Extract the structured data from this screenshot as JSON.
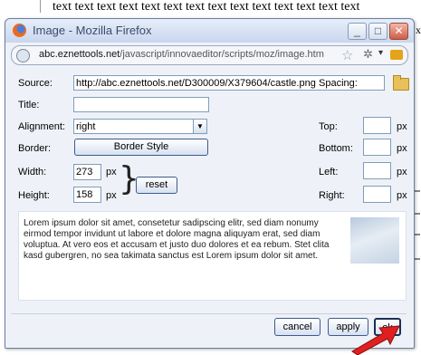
{
  "background": {
    "text": "text text text text text text text text text text text text text text",
    "edge_text": "x"
  },
  "window": {
    "title": "Image - Mozilla Firefox",
    "controls": {
      "minimize": "_",
      "maximize": "□",
      "close": "✕"
    },
    "url": {
      "domain": "abc.eznettools.net",
      "path": "/javascript/innovaeditor/scripts/moz/image.htm"
    }
  },
  "form": {
    "source_label": "Source:",
    "source_value": "http://abc.eznettools.net/D300009/X379604/castle.png",
    "title_label": "Title:",
    "title_value": "",
    "alignment_label": "Alignment:",
    "alignment_value": "right",
    "border_label": "Border:",
    "border_style_button": "Border Style",
    "width_label": "Width:",
    "width_value": "273",
    "width_unit": "px",
    "height_label": "Height:",
    "height_value": "158",
    "height_unit": "px",
    "reset_button": "reset",
    "spacing_label": "Spacing:",
    "top_label": "Top:",
    "bottom_label": "Bottom:",
    "left_label": "Left:",
    "right_label": "Right:",
    "spacing_unit": "px"
  },
  "preview": {
    "text": "Lorem ipsum dolor sit amet, consetetur sadipscing elitr, sed diam nonumy eirmod tempor invidunt ut labore et dolore magna aliquyam erat, sed diam voluptua. At vero eos et accusam et justo duo dolores et ea rebum. Stet clita kasd gubergren, no sea takimata sanctus est Lorem ipsum dolor sit amet."
  },
  "actions": {
    "cancel": "cancel",
    "apply": "apply",
    "ok": "ok"
  },
  "colors": {
    "accent": "#3d5a8a",
    "arrow": "#e02020"
  },
  "icons": [
    "firefox-icon",
    "globe-icon",
    "star-icon",
    "tools-icon",
    "rss-icon",
    "folder-icon",
    "cursor-arrow-icon"
  ]
}
